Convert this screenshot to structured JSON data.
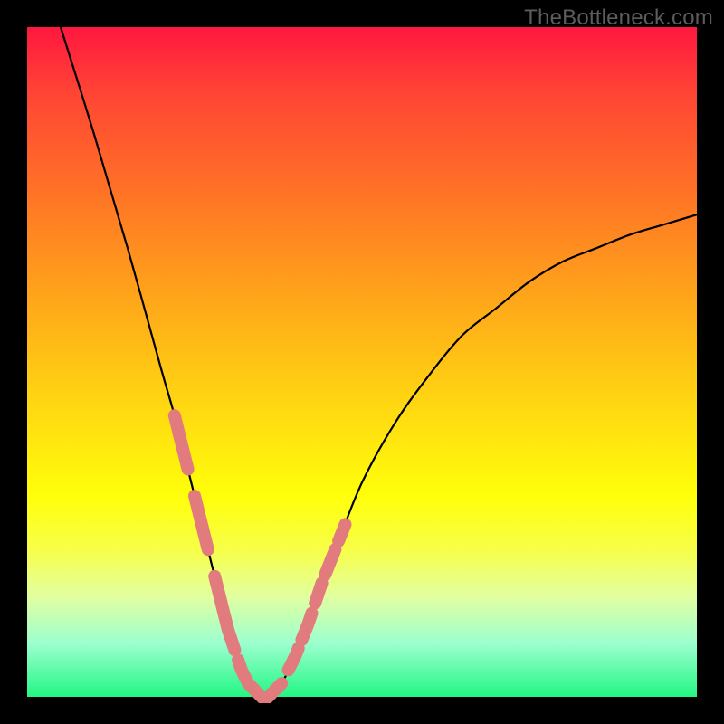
{
  "watermark": "TheBottleneck.com",
  "colors": {
    "background": "#000000",
    "gradient_top": "#ff173f",
    "gradient_bottom": "#22f783",
    "curve": "#000000",
    "markers": "#e27b7e"
  },
  "chart_data": {
    "type": "line",
    "title": "",
    "xlabel": "",
    "ylabel": "",
    "xlim": [
      0,
      100
    ],
    "ylim": [
      0,
      100
    ],
    "x": [
      5,
      10,
      15,
      20,
      22,
      24,
      26,
      28,
      30,
      31,
      32,
      33,
      34,
      35,
      36,
      37,
      38,
      40,
      42,
      44,
      46,
      50,
      55,
      60,
      65,
      70,
      75,
      80,
      85,
      90,
      95,
      100
    ],
    "y": [
      100,
      84,
      67,
      49,
      42,
      34,
      26,
      18,
      10,
      7,
      4,
      2,
      1,
      0,
      0,
      1,
      2,
      6,
      11,
      17,
      22,
      32,
      41,
      48,
      54,
      58,
      62,
      65,
      67,
      69,
      70.5,
      72
    ],
    "markers": [
      {
        "x_range": [
          22,
          24
        ],
        "side": "left"
      },
      {
        "x_range": [
          25,
          27
        ],
        "side": "left"
      },
      {
        "x_range": [
          28,
          30
        ],
        "side": "left"
      },
      {
        "x_range": [
          30,
          31
        ],
        "side": "left"
      },
      {
        "x_range": [
          31.5,
          33
        ],
        "side": "left"
      },
      {
        "x_range": [
          33,
          34
        ],
        "side": "bottom"
      },
      {
        "x_range": [
          34.5,
          36.5
        ],
        "side": "bottom"
      },
      {
        "x_range": [
          37,
          38
        ],
        "side": "bottom"
      },
      {
        "x_range": [
          39,
          40.5
        ],
        "side": "right"
      },
      {
        "x_range": [
          41,
          42.5
        ],
        "side": "right"
      },
      {
        "x_range": [
          43,
          44
        ],
        "side": "right"
      },
      {
        "x_range": [
          44.5,
          46
        ],
        "side": "right"
      },
      {
        "x_range": [
          46.5,
          47.5
        ],
        "side": "right"
      }
    ],
    "notes": "V-shaped bottleneck curve; minimum at x≈35, y=0. Values estimated from pixels as no axis ticks are shown."
  }
}
